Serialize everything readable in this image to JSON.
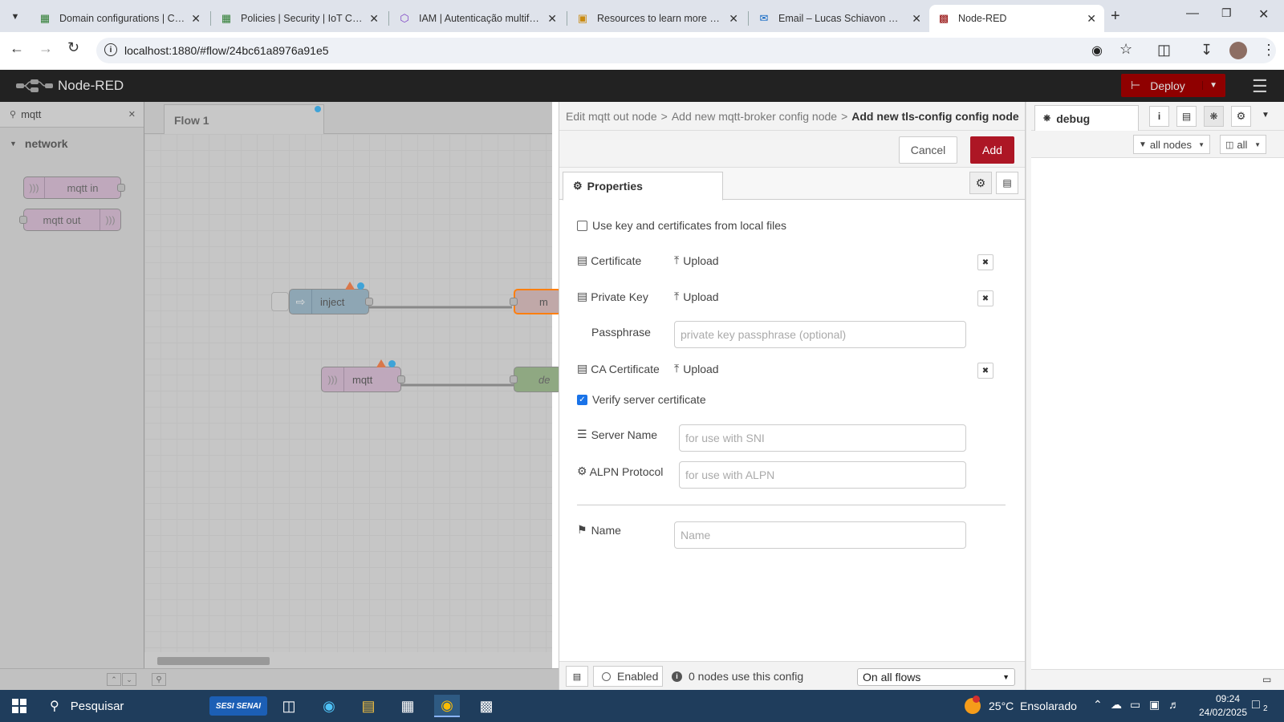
{
  "browser": {
    "tabs": [
      {
        "title": "Domain configurations | Con",
        "icon": "aws-green-icon"
      },
      {
        "title": "Policies | Security | IoT Core |",
        "icon": "aws-green-icon"
      },
      {
        "title": "IAM | Autenticação multifato",
        "icon": "cube-icon"
      },
      {
        "title": "Resources to learn more abo",
        "icon": "bookmark-icon"
      },
      {
        "title": "Email – Lucas Schiavon Calu",
        "icon": "outlook-icon"
      },
      {
        "title": "Node-RED",
        "icon": "node-red-icon"
      }
    ],
    "url": "localhost:1880/#flow/24bc61a8976a91e5"
  },
  "app": {
    "title": "Node-RED",
    "deploy_label": "Deploy"
  },
  "palette": {
    "search_value": "mqtt",
    "category": "network",
    "nodes": [
      "mqtt in",
      "mqtt out"
    ]
  },
  "workspace": {
    "tab": "Flow 1",
    "nodes": [
      {
        "label": "inject"
      },
      {
        "label": "m"
      },
      {
        "label": "mqtt"
      },
      {
        "label": "de"
      }
    ]
  },
  "editor": {
    "breadcrumb_1": "Edit mqtt out node",
    "breadcrumb_2": "Add new mqtt-broker config node",
    "breadcrumb_sep": ">",
    "breadcrumb_current": "Add new tls-config config node",
    "cancel_label": "Cancel",
    "add_label": "Add",
    "properties_tab": "Properties",
    "use_local_files_label": "Use key and certificates from local files",
    "use_local_files_checked": false,
    "certificate_label": "Certificate",
    "private_key_label": "Private Key",
    "passphrase_label": "Passphrase",
    "passphrase_placeholder": "private key passphrase (optional)",
    "ca_certificate_label": "CA Certificate",
    "upload_label": "Upload",
    "verify_label": "Verify server certificate",
    "verify_checked": true,
    "server_name_label": "Server Name",
    "server_name_placeholder": "for use with SNI",
    "alpn_label": "ALPN Protocol",
    "alpn_placeholder": "for use with ALPN",
    "name_label": "Name",
    "name_placeholder": "Name",
    "footer": {
      "enabled_label": "Enabled",
      "usage_text": "0 nodes use this config",
      "scope_value": "On all flows"
    }
  },
  "sidebar": {
    "tab_label": "debug",
    "filter_label": "all nodes",
    "clear_label": "all"
  },
  "taskbar": {
    "search_placeholder": "Pesquisar",
    "badge_label": "SESI SENAI",
    "weather": "25°C  Ensolarado",
    "time": "09:24",
    "date": "24/02/2025",
    "notification_count": "2"
  },
  "colors": {
    "deploy_bg": "#8f0000",
    "add_button": "#ad1625",
    "node_red_header": "#222222",
    "taskbar": "#1f3d5c"
  }
}
